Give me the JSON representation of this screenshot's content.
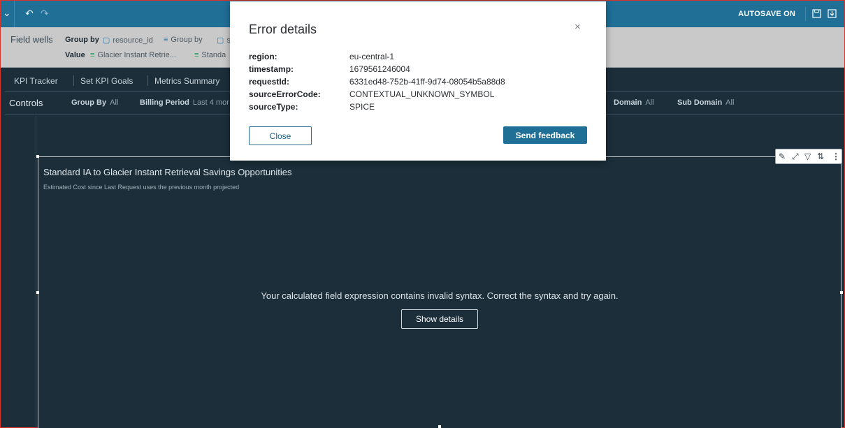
{
  "toolbar": {
    "autosave_label": "AUTOSAVE ON",
    "menu_icon": "chevron-down-icon",
    "undo_icon": "undo-icon",
    "redo_icon": "redo-icon",
    "save_icon": "save-icon",
    "export_icon": "download-icon"
  },
  "field_wells": {
    "title": "Field wells",
    "group_by_label": "Group by",
    "value_label": "Value",
    "group_by_items": [
      "resource_id",
      "Group by",
      "s"
    ],
    "value_items": [
      "Glacier Instant Retrie...",
      "Standa"
    ]
  },
  "tabs": [
    "KPI Tracker",
    "Set KPI Goals",
    "Metrics Summary"
  ],
  "controls": {
    "title": "Controls",
    "items": [
      {
        "label": "Group By",
        "value": "All"
      },
      {
        "label": "Billing Period",
        "value": "Last 4 mor"
      },
      {
        "label": "Domain",
        "value": "All"
      },
      {
        "label": "Sub Domain",
        "value": "All"
      }
    ]
  },
  "visual": {
    "title": "Standard IA to Glacier Instant Retrieval Savings Opportunities",
    "subtitle": "Estimated Cost since Last Request uses the previous month projected",
    "error_message": "Your calculated field expression contains invalid syntax. Correct the syntax and try again.",
    "show_details_label": "Show details",
    "menu_icons": [
      "pencil-icon",
      "expand-icon",
      "filter-icon",
      "sort-icon",
      "more-vertical-icon"
    ]
  },
  "modal": {
    "title": "Error details",
    "details": [
      {
        "key": "region:",
        "value": "eu-central-1"
      },
      {
        "key": "timestamp:",
        "value": "1679561246004"
      },
      {
        "key": "requestId:",
        "value": "6331ed48-752b-41ff-9d74-08054b5a88d8"
      },
      {
        "key": "sourceErrorCode:",
        "value": "CONTEXTUAL_UNKNOWN_SYMBOL"
      },
      {
        "key": "sourceType:",
        "value": "SPICE"
      }
    ],
    "close_label": "Close",
    "feedback_label": "Send feedback"
  }
}
